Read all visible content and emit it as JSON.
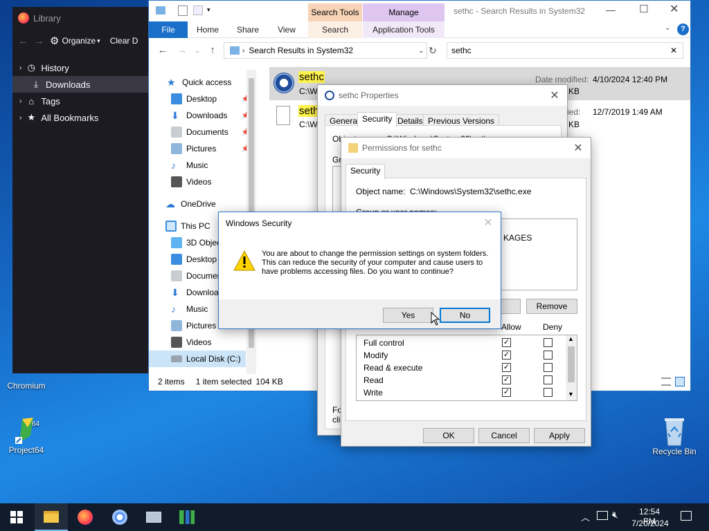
{
  "desktop": {
    "icons": [
      {
        "label": "Chromium"
      },
      {
        "label": "Project64"
      },
      {
        "label": "Recycle Bin"
      }
    ]
  },
  "library": {
    "title": "Library",
    "toolbar": {
      "organize": "Organize",
      "clear": "Clear D"
    },
    "tree": [
      {
        "label": "History",
        "icon": "history-icon"
      },
      {
        "label": "Downloads",
        "icon": "download-icon"
      },
      {
        "label": "Tags",
        "icon": "tag-icon"
      },
      {
        "label": "All Bookmarks",
        "icon": "star-icon"
      }
    ]
  },
  "explorer": {
    "title": "sethc - Search Results in System32",
    "context_tabs": {
      "search_tools": "Search Tools",
      "manage": "Manage"
    },
    "ribbon_tabs": [
      "File",
      "Home",
      "Share",
      "View",
      "Search",
      "Application Tools"
    ],
    "address": "Search Results in System32",
    "search_value": "sethc",
    "nav": {
      "quick_access": "Quick access",
      "quick_items": [
        "Desktop",
        "Downloads",
        "Documents",
        "Pictures",
        "Music",
        "Videos"
      ],
      "onedrive": "OneDrive",
      "this_pc": "This PC",
      "pc_items": [
        "3D Objects",
        "Desktop",
        "Documents",
        "Downloads",
        "Music",
        "Pictures",
        "Videos",
        "Local Disk (C:)"
      ]
    },
    "files": [
      {
        "name": "sethc",
        "path": "C:\\W",
        "date_label": "Date modified:",
        "date": "4/10/2024 12:40 PM",
        "size": "KB"
      },
      {
        "name": "seth",
        "path": "C:\\W",
        "date_label": "ified:",
        "date": "12/7/2019 1:49 AM",
        "size": "KB"
      }
    ],
    "status": {
      "items": "2 items",
      "selected": "1 item selected",
      "size": "104 KB"
    }
  },
  "properties": {
    "title": "sethc Properties",
    "tabs": [
      "General",
      "Security",
      "Details",
      "Previous Versions"
    ],
    "object_label": "Object name:",
    "object_value": "C:\\Windows\\System32\\sethc.exe",
    "group_label": "Gro",
    "for_text": "For",
    "click_text": "clic"
  },
  "permissions": {
    "title": "Permissions for sethc",
    "tab": "Security",
    "object_label": "Object name:",
    "object_value": "C:\\Windows\\System32\\sethc.exe",
    "group_label": "Group or user names:",
    "group_entry": "KAGES",
    "remove_label": "Remove",
    "allow_label": "Allow",
    "deny_label": "Deny",
    "perms": [
      {
        "name": "Full control",
        "allow": true,
        "deny": false
      },
      {
        "name": "Modify",
        "allow": true,
        "deny": false
      },
      {
        "name": "Read & execute",
        "allow": true,
        "deny": false
      },
      {
        "name": "Read",
        "allow": true,
        "deny": false
      },
      {
        "name": "Write",
        "allow": true,
        "deny": false
      }
    ],
    "ok": "OK",
    "cancel": "Cancel",
    "apply": "Apply"
  },
  "security_dialog": {
    "title": "Windows Security",
    "message": "You are about to change the permission settings on system folders. This can reduce the security of your computer and cause users to have problems accessing files. Do you want to continue?",
    "yes": "Yes",
    "no": "No"
  },
  "taskbar": {
    "time": "12:54 PM",
    "date": "7/20/2024"
  }
}
